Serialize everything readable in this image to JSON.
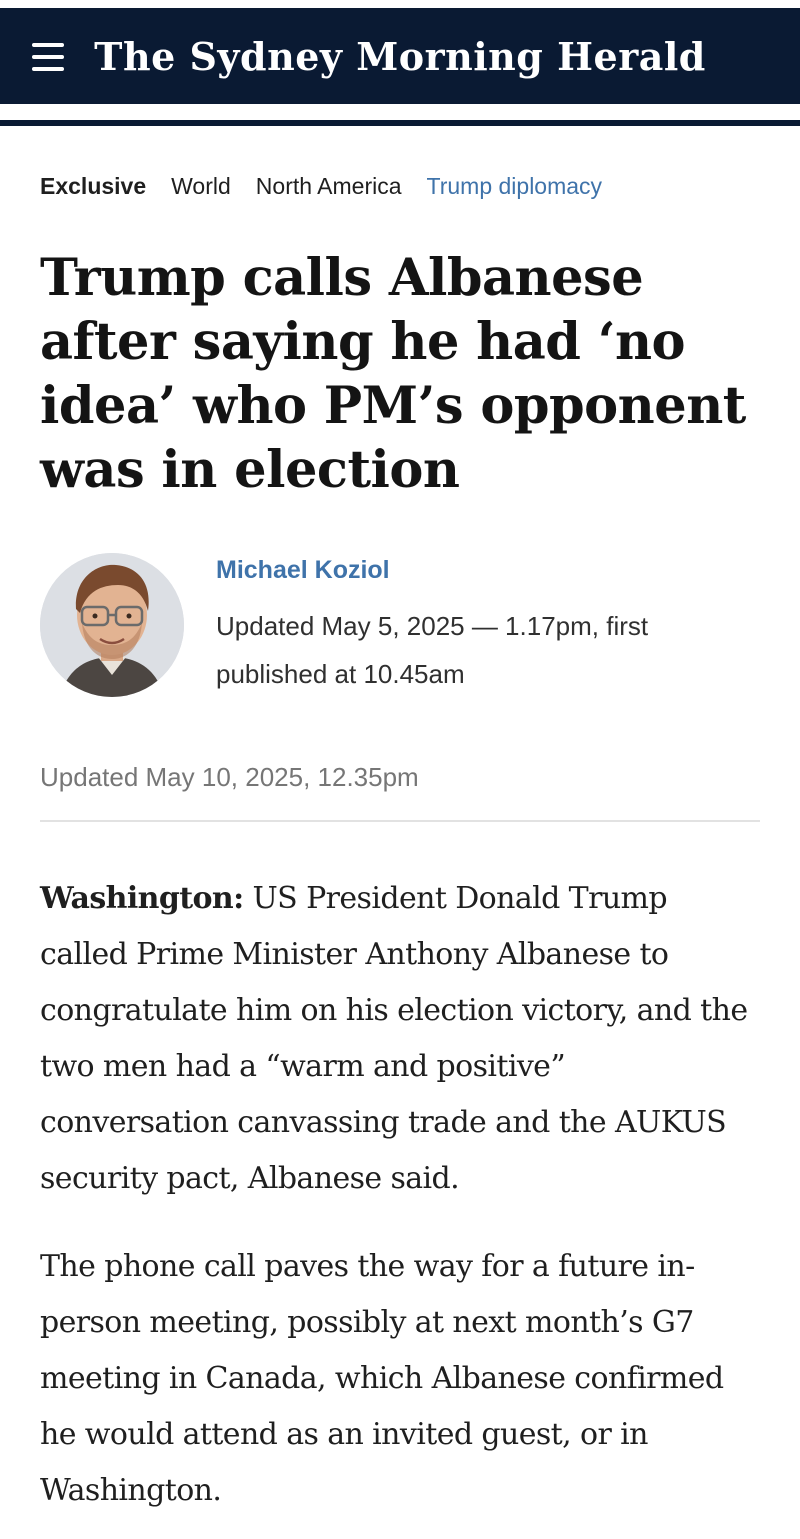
{
  "masthead": {
    "menu_icon": "hamburger-menu-icon",
    "logo_text": "The Sydney Morning Herald"
  },
  "breadcrumbs": [
    {
      "label": "Exclusive"
    },
    {
      "label": "World"
    },
    {
      "label": "North America"
    },
    {
      "label": "Trump diplomacy"
    }
  ],
  "article": {
    "headline": "Trump calls Albanese after saying he had ‘no idea’ who PM’s opponent was in election",
    "author": {
      "name": "Michael Koziol",
      "photo_icon": "author-portrait"
    },
    "published": "Updated May 5, 2025 — 1.17pm, first published at 10.45am",
    "updated": "Updated May 10, 2025, 12.35pm",
    "paragraphs": [
      {
        "dateline": "Washington:",
        "text": " US President Donald Trump called Prime Minister Anthony Albanese to congratulate him on his election victory, and the two men had a “warm and positive” conversation canvassing trade and the AUKUS security pact, Albanese said."
      },
      {
        "text": "The phone call paves the way for a future in-person meeting, possibly at next month’s G7 meeting in Canada, which Albanese confirmed he would attend as an invited guest, or in Washington."
      }
    ]
  },
  "colors": {
    "masthead_bg": "#0a1a33",
    "accent_link": "#3f73aa"
  }
}
